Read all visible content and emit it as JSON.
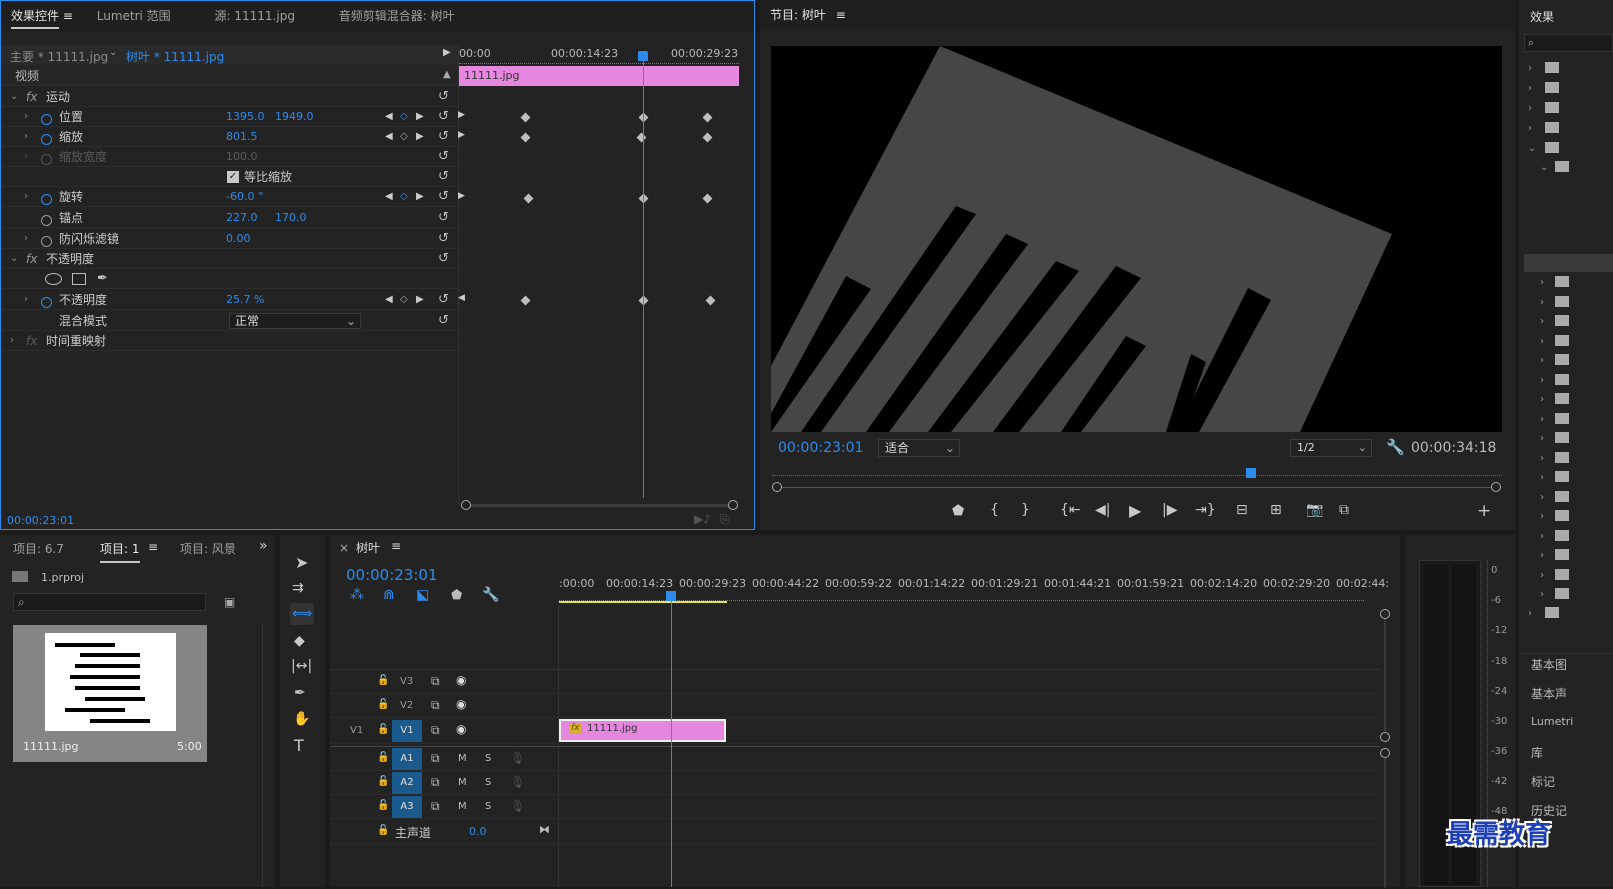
{
  "effect_controls": {
    "tabs": [
      "效果控件",
      "Lumetri 范围",
      "源: 11111.jpg",
      "音频剪辑混合器: 树叶"
    ],
    "menu_icon": "≡",
    "master_label": "主要 * 11111.jpg",
    "clip_label": "树叶 * 11111.jpg",
    "ruler": [
      "00:00",
      "00:00:14:23",
      "00:00:29:23"
    ],
    "clip_name": "11111.jpg",
    "video_header": "视频",
    "motion": "运动",
    "position_label": "位置",
    "position_x": "1395.0",
    "position_y": "1949.0",
    "scale_label": "缩放",
    "scale_value": "801.5",
    "scale_width_label": "缩放宽度",
    "scale_width_value": "100.0",
    "uniform_scale_label": "等比缩放",
    "rotation_label": "旋转",
    "rotation_value": "-60.0 °",
    "anchor_label": "锚点",
    "anchor_x": "227.0",
    "anchor_y": "170.0",
    "flicker_label": "防闪烁滤镜",
    "flicker_value": "0.00",
    "opacity_header": "不透明度",
    "opacity_label": "不透明度",
    "opacity_value": "25.7 %",
    "blend_label": "混合模式",
    "blend_value": "正常",
    "time_remap": "时间重映射",
    "timecode": "00:00:23:01"
  },
  "program": {
    "title": "节目: 树叶",
    "menu_icon": "≡",
    "timecode": "00:00:23:01",
    "fit": "适合",
    "resolution": "1/2",
    "duration": "00:00:34:18"
  },
  "effects_panel": {
    "title": "效果",
    "items": [
      "基本图",
      "基本声",
      "Lumetri",
      "库",
      "标记",
      "历史记"
    ]
  },
  "project": {
    "tabs": [
      "项目: 6.7",
      "项目: 1",
      "项目: 风景"
    ],
    "menu_icon": "≡",
    "more": "»",
    "file": "1.prproj",
    "thumb_name": "11111.jpg",
    "thumb_duration": "5:00"
  },
  "timeline": {
    "close": "×",
    "title": "树叶",
    "menu_icon": "≡",
    "timecode": "00:00:23:01",
    "ruler": [
      ":00:00",
      "00:00:14:23",
      "00:00:29:23",
      "00:00:44:22",
      "00:00:59:22",
      "00:01:14:22",
      "00:01:29:21",
      "00:01:44:21",
      "00:01:59:21",
      "00:02:14:20",
      "00:02:29:20",
      "00:02:44:"
    ],
    "video_tracks": [
      "V3",
      "V2",
      "V1"
    ],
    "source_v": "V1",
    "audio_tracks": [
      "A1",
      "A2",
      "A3"
    ],
    "mute": "M",
    "solo": "S",
    "master": "主声道",
    "master_value": "0.0",
    "clip_name": "11111.jpg",
    "fx": "fx"
  },
  "meter": {
    "scale": [
      "0",
      "-6",
      "-12",
      "-18",
      "-24",
      "-30",
      "-36",
      "-42",
      "-48"
    ]
  },
  "watermark": "最需教育",
  "colors": {
    "accent": "#2d8ceb",
    "clip": "#e586df",
    "track_blue": "#1b5a8d"
  }
}
